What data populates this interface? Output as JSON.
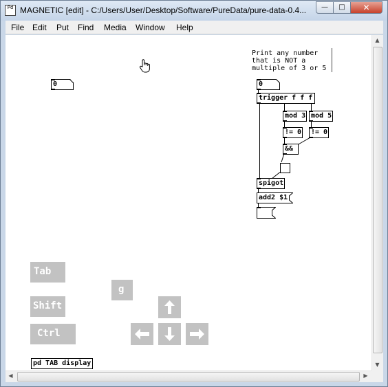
{
  "window": {
    "title": "MAGNETIC  [edit] - C:/Users/User/Desktop/Software/PureData/pure-data-0.4...",
    "icon_label": "Pd",
    "buttons": {
      "minimize": "—",
      "maximize": "□",
      "close": "✕"
    }
  },
  "menu": {
    "items": [
      {
        "label": "File"
      },
      {
        "label": "Edit"
      },
      {
        "label": "Put"
      },
      {
        "label": "Find"
      },
      {
        "label": "Media"
      },
      {
        "label": "Window"
      },
      {
        "label": "Help"
      }
    ]
  },
  "patch": {
    "comment": "Print any number\nthat is NOT a\nmultiple of 3 or 5",
    "numbox_left": "0",
    "numbox_input": "0",
    "trigger": "trigger f f f",
    "mod3": "mod 3",
    "mod5": "mod 5",
    "ne0_a": "!= 0",
    "ne0_b": "!= 0",
    "and": "&&",
    "spigot": "spigot",
    "add2": "add2 $1",
    "subpatch": "pd TAB display"
  },
  "keys": {
    "tab": "Tab",
    "shift": "Shift",
    "ctrl": "Ctrl",
    "g": "g",
    "up": "🡑",
    "left": "🡐",
    "down": "🡓",
    "right": "🡒"
  },
  "colors": {
    "key_bg": "#c2c2c2",
    "key_text": "#ffffff",
    "close_button": "#c7412b"
  }
}
